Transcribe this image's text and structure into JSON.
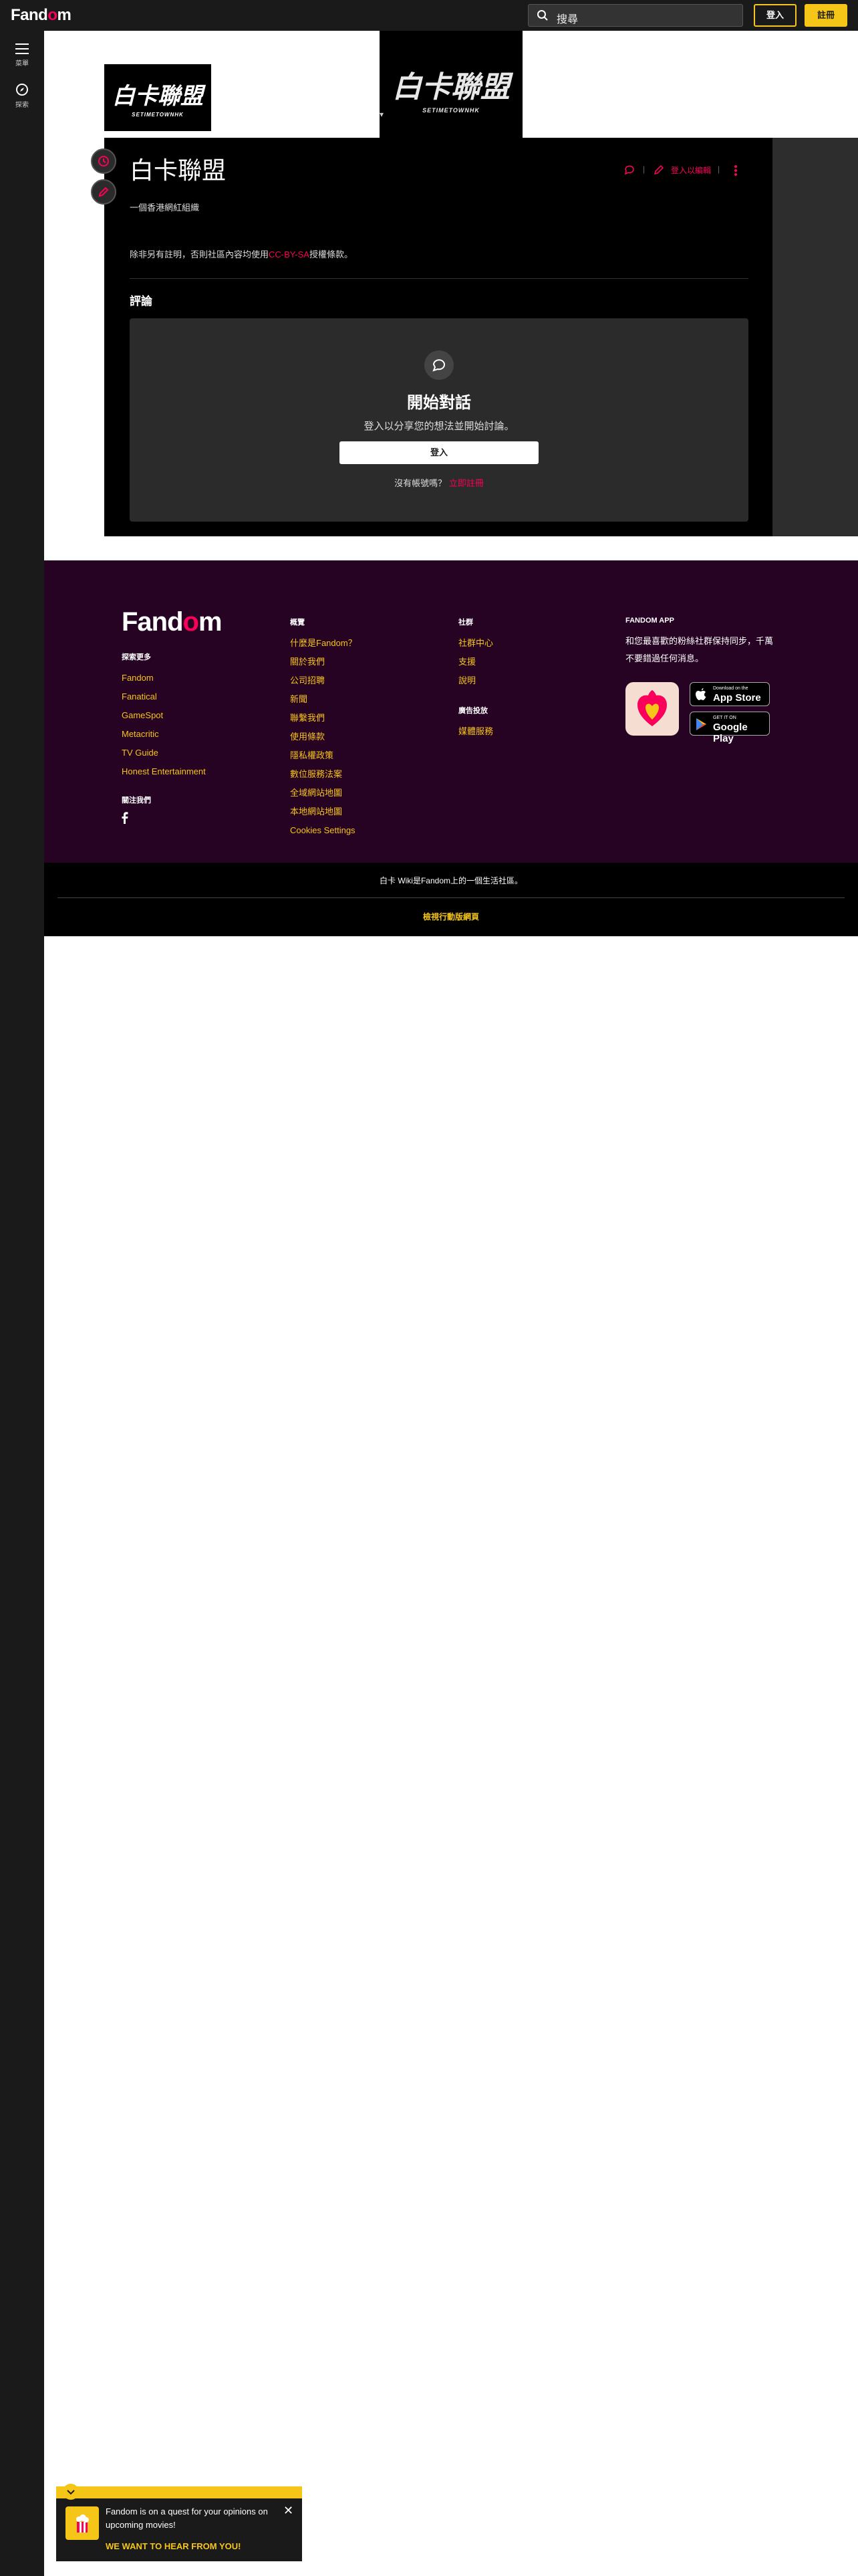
{
  "topnav": {
    "brand": "Fandom",
    "search_label": "搜尋",
    "signin": "登入",
    "register": "註冊"
  },
  "rail": {
    "menu_label": "菜單",
    "explore_label": "探索"
  },
  "header": {
    "wiki_name": "白卡聯盟",
    "logo_sub": "SETIMETOWNHK"
  },
  "article": {
    "title": "白卡聯盟",
    "edit_label": "登入以編輯",
    "description": "一個香港網紅組織",
    "license_prefix": "除非另有註明，否則社區內容均使用",
    "license_link": "CC-BY-SA",
    "license_suffix": "授權條款。",
    "comments_heading": "評論"
  },
  "comments": {
    "title": "開始對話",
    "subtitle": "登入以分享您的想法並開始討論。",
    "signin_button": "登入",
    "no_account": "沒有帳號嗎？",
    "register_link": "立即註冊"
  },
  "footer": {
    "logo": "Fandom",
    "explore": {
      "heading": "探索更多",
      "links": [
        "Fandom",
        "Fanatical",
        "GameSpot",
        "Metacritic",
        "TV Guide",
        "Honest Entertainment"
      ]
    },
    "follow_heading": "關注我們",
    "overview": {
      "heading": "概覽",
      "links": [
        "什麼是Fandom？",
        "關於我們",
        "公司招聘",
        "新聞",
        "聯繫我們",
        "使用條款",
        "隱私權政策",
        "數位服務法案",
        "全域網站地圖",
        "本地網站地圖",
        "Cookies Settings"
      ]
    },
    "community": {
      "heading": "社群",
      "links": [
        "社群中心",
        "支援",
        "說明"
      ]
    },
    "ads": {
      "heading": "廣告投放",
      "links": [
        "媒體服務"
      ]
    },
    "app": {
      "heading": "FANDOM APP",
      "description": "和您最喜歡的粉絲社群保持同步，千萬不要錯過任何消息。",
      "appstore_small": "Download on the",
      "appstore_big": "App Store",
      "googleplay_small": "GET IT ON",
      "googleplay_big": "Google Play"
    },
    "community_line": "白卡 Wiki是Fandom上的一個生活社區。",
    "mobile_link": "檢視行動版網頁"
  },
  "toast": {
    "message": "Fandom is on a quest for your opinions on upcoming movies!",
    "cta": "WE WANT TO HEAR FROM YOU!"
  },
  "colors": {
    "accent": "#fa005a",
    "cta": "#f5c518",
    "footer_bg": "#260223"
  }
}
